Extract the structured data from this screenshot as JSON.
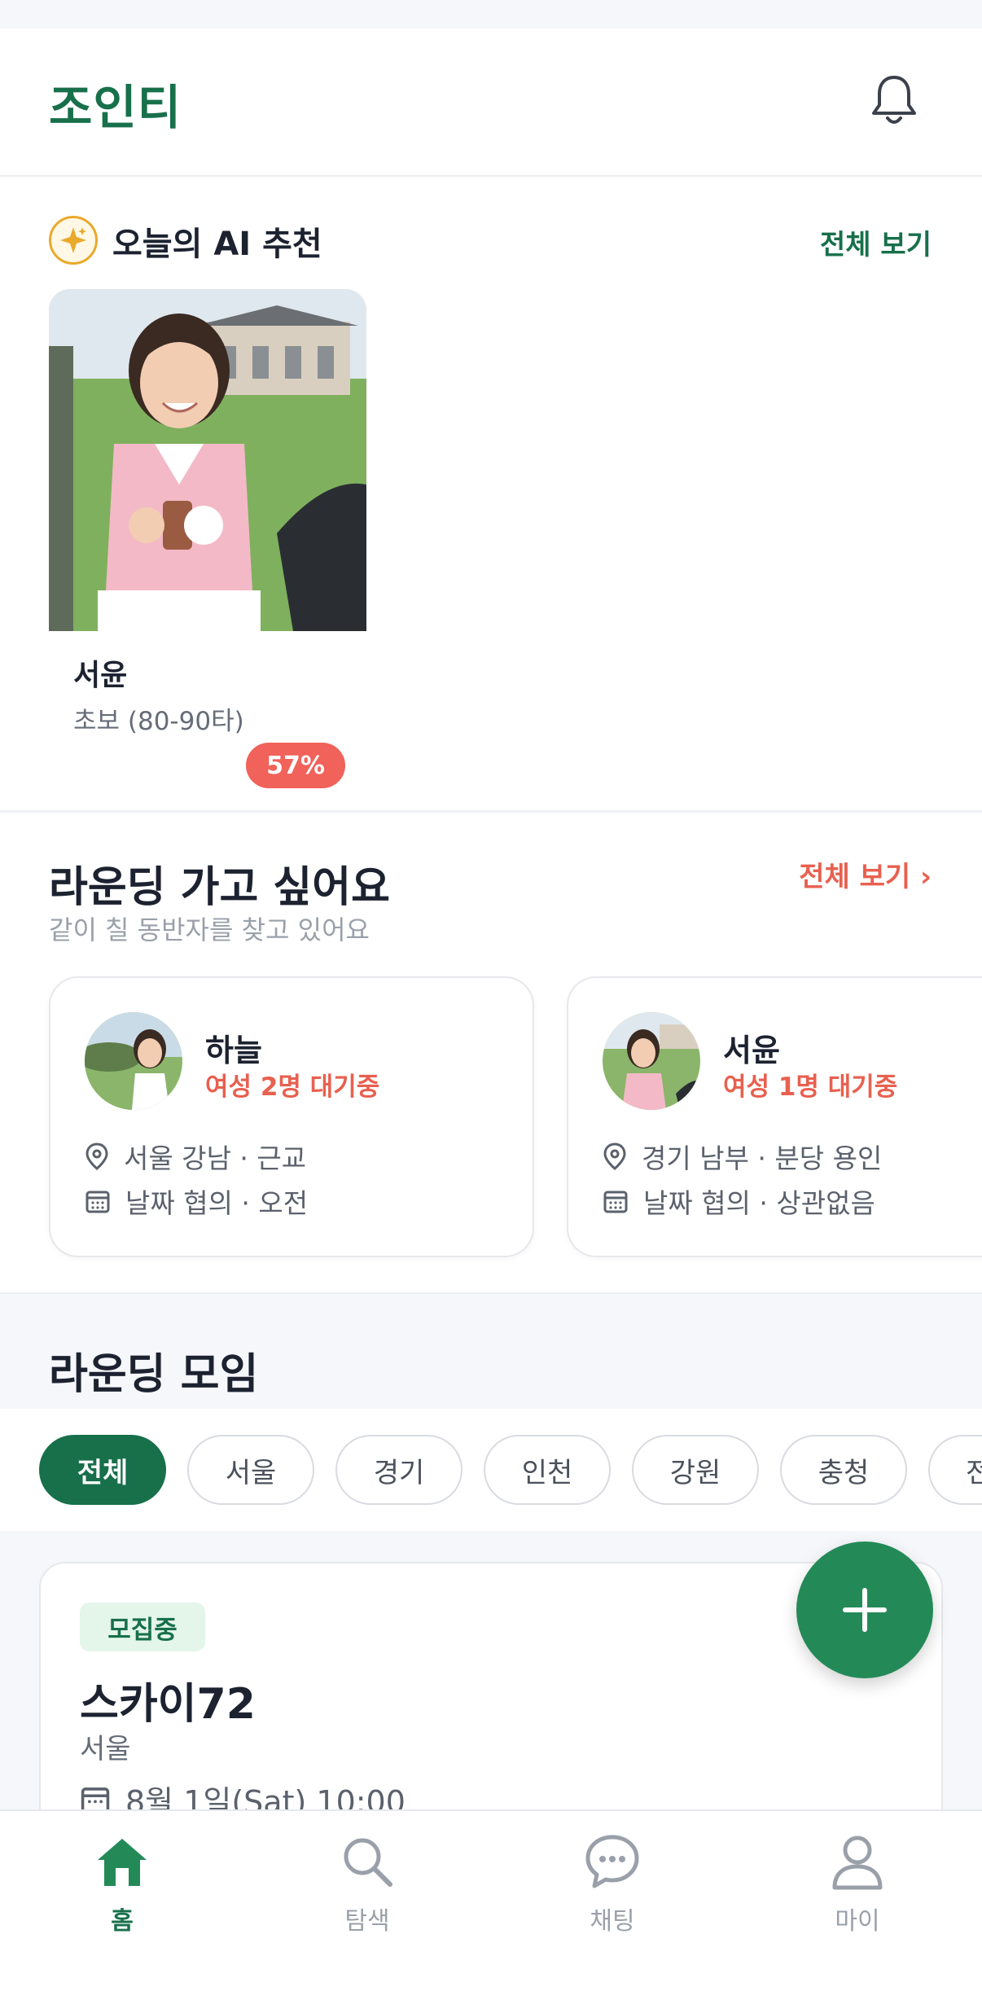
{
  "app": {
    "title": "조인티",
    "notification_icon": "bell-icon"
  },
  "ai_recommend": {
    "title": "오늘의 AI 추천",
    "see_all": "전체 보기",
    "items": [
      {
        "name": "서윤",
        "level": "초보 (80-90타)",
        "match": "57%"
      }
    ]
  },
  "rounding_wanted": {
    "title": "라운딩 가고 싶어요",
    "subtitle": "같이 칠 동반자를 찾고 있어요",
    "see_all": "전체 보기 ›",
    "cards": [
      {
        "name": "하늘",
        "status": "여성 2명 대기중",
        "location": "서울 강남 · 근교",
        "schedule": "날짜 협의 · 오전"
      },
      {
        "name": "서윤",
        "status": "여성 1명 대기중",
        "location": "경기 남부 · 분당 용인",
        "schedule": "날짜 협의 · 상관없음"
      }
    ]
  },
  "meetings": {
    "title": "라운딩 모임",
    "filters": [
      "전체",
      "서울",
      "경기",
      "인천",
      "강원",
      "충청",
      "전"
    ],
    "selected_filter": "전체",
    "items": [
      {
        "badge": "모집중",
        "course": "스카이72",
        "region": "서울",
        "datetime": "8월 1일(Sat) 10:00"
      }
    ]
  },
  "fab": {
    "icon": "plus-icon"
  },
  "bottom_nav": [
    {
      "label": "홈",
      "icon": "home-icon",
      "active": true
    },
    {
      "label": "탐색",
      "icon": "search-icon",
      "active": false
    },
    {
      "label": "채팅",
      "icon": "chat-icon",
      "active": false
    },
    {
      "label": "마이",
      "icon": "user-icon",
      "active": false
    }
  ],
  "colors": {
    "brand": "#17704a",
    "accent_red": "#e8604f",
    "match_pill": "#f0625a"
  }
}
